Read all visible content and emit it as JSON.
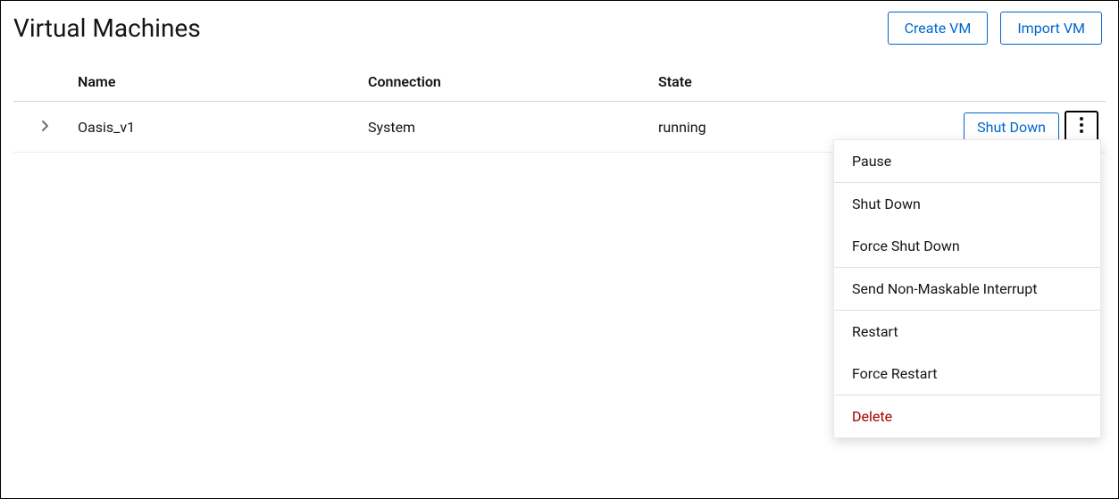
{
  "header": {
    "title": "Virtual Machines",
    "create_btn": "Create VM",
    "import_btn": "Import VM"
  },
  "table": {
    "columns": {
      "name": "Name",
      "connection": "Connection",
      "state": "State"
    },
    "rows": [
      {
        "name": "Oasis_v1",
        "connection": "System",
        "state": "running",
        "primary_action": "Shut Down"
      }
    ]
  },
  "dropdown": {
    "pause": "Pause",
    "shutdown": "Shut Down",
    "force_shutdown": "Force Shut Down",
    "nmi": "Send Non-Maskable Interrupt",
    "restart": "Restart",
    "force_restart": "Force Restart",
    "delete": "Delete"
  }
}
